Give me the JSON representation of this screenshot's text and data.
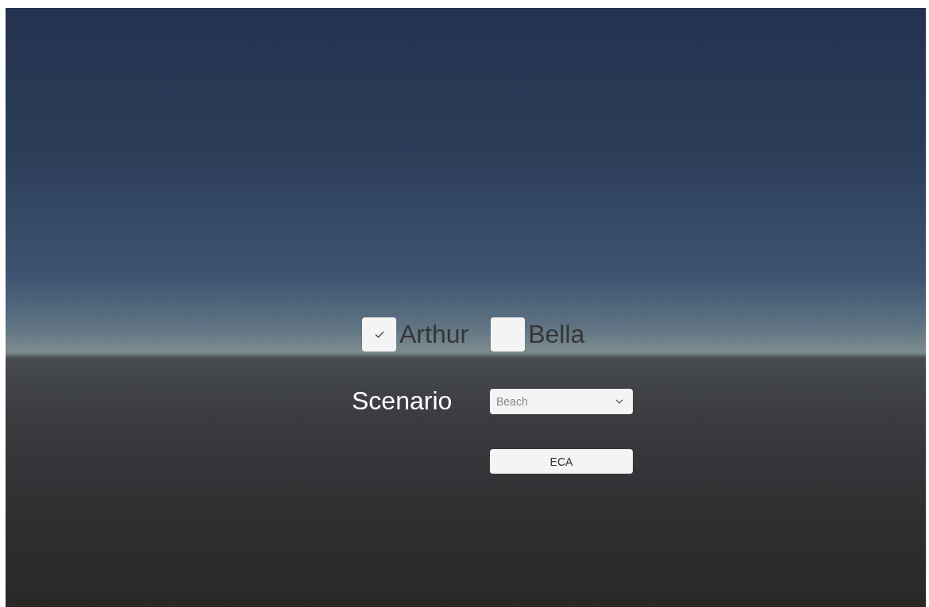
{
  "characters": [
    {
      "label": "Arthur",
      "checked": true
    },
    {
      "label": "Bella",
      "checked": false
    }
  ],
  "scenario": {
    "label": "Scenario",
    "value": "Beach"
  },
  "button": {
    "label": "ECA"
  }
}
